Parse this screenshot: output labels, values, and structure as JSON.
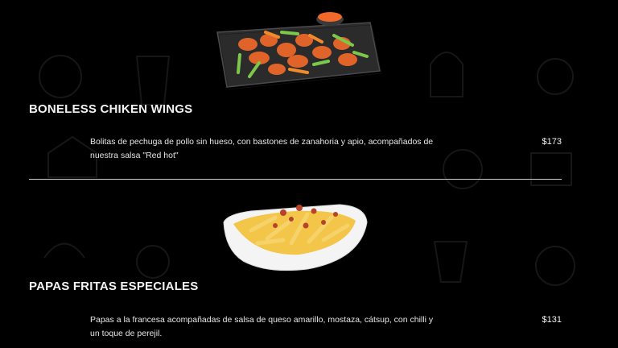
{
  "theme": {
    "background": "#000000",
    "text": "#ffffff",
    "divider": "#cfcfcf"
  },
  "menu": {
    "items": [
      {
        "title": "BONELESS CHIKEN WINGS",
        "description": "Bolitas de pechuga de pollo sin hueso, con bastones de zanahoria y apio, acompañados de nuestra salsa \"Red hot\"",
        "price": "$173",
        "image": "wings-on-slate-plate-image"
      },
      {
        "title": "PAPAS FRITAS ESPECIALES",
        "description": "Papas a la francesa acompañadas de salsa de queso amarillo, mostaza, cátsup, con chilli y un toque de perejil.",
        "price": "$131",
        "image": "fries-in-white-bowl-image"
      }
    ]
  }
}
